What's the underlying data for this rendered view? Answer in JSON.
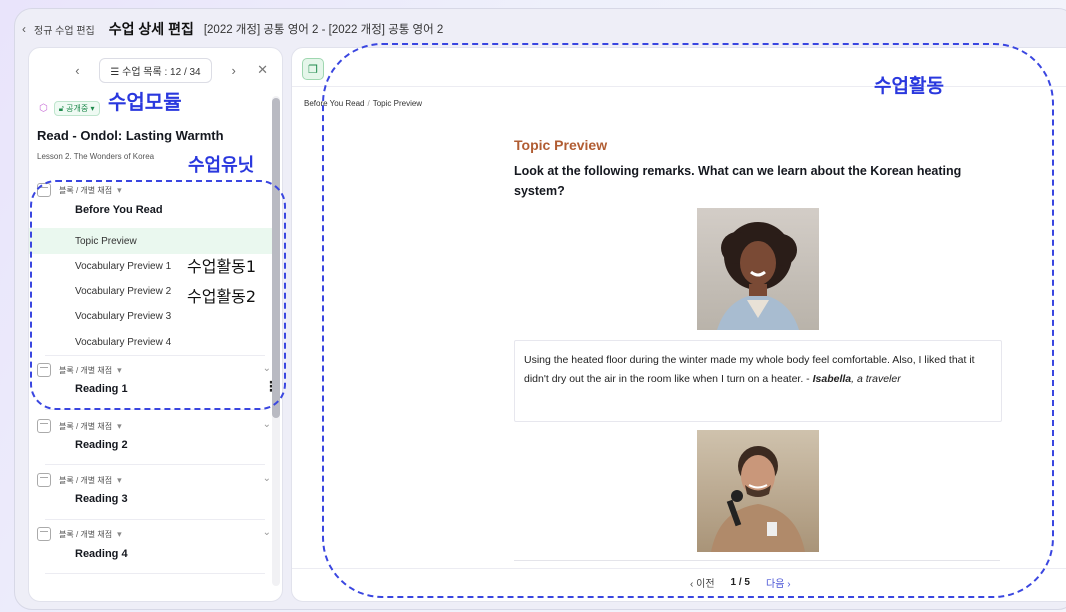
{
  "topbar": {
    "back_icon": "chevron-left-icon",
    "crumb": "정규 수업 편집",
    "title": "수업 상세 편집",
    "course": "[2022 개정] 공통 영어 2 - [2022 개정] 공통 영어 2"
  },
  "left": {
    "pager": {
      "list_label": "수업 목록 : 12 / 34"
    },
    "status_badge": "공개중",
    "module_title": "Read - Ondol: Lasting Warmth",
    "module_subtitle": "Lesson 2. The Wonders of Korea",
    "unit_type_label": "블록 / 개별 채점",
    "units": [
      {
        "title": "Before You Read",
        "activities": [
          "Topic Preview",
          "Vocabulary Preview 1",
          "Vocabulary Preview 2",
          "Vocabulary Preview 3",
          "Vocabulary Preview 4"
        ]
      },
      {
        "title": "Reading 1"
      },
      {
        "title": "Reading 2"
      },
      {
        "title": "Reading 3"
      },
      {
        "title": "Reading 4"
      }
    ]
  },
  "right": {
    "breadcrumb": {
      "first": "Before You Read",
      "second": "Topic Preview"
    },
    "activity_title": "Topic Preview",
    "question": "Look at the following remarks. What can we learn about the Korean heating system?",
    "quote": {
      "text": "Using the heated floor during the winter made my whole body feel comfortable. Also, I liked that it didn't dry out the air in the room like when I turn on a heater.",
      "dash": " - ",
      "author": "Isabella",
      "role": ", a traveler"
    },
    "pagination": {
      "prev": "이전",
      "page": "1 / 5",
      "next": "다음"
    }
  },
  "annotations": {
    "module": "수업모듈",
    "unit": "수업유닛",
    "activity1": "수업활동1",
    "activity2": "수업활동2",
    "activity": "수업활동"
  },
  "colors": {
    "accent_green": "#1f8a4c",
    "activity_title": "#b15d33",
    "annotation_blue": "#2a38de"
  }
}
